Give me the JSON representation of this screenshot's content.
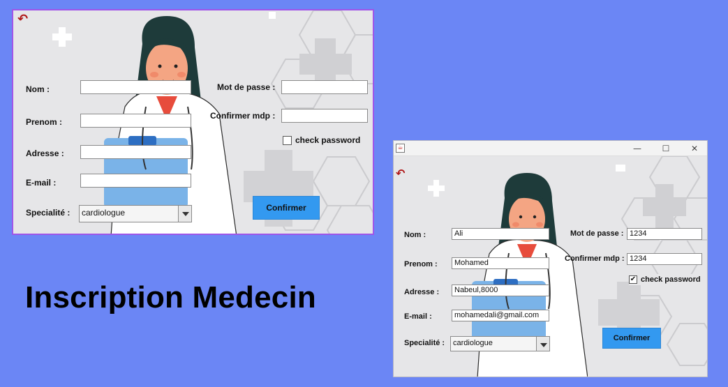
{
  "heading": "Inscription Medecin",
  "icons": {
    "back": "back-arrow-icon",
    "app": "java-icon"
  },
  "window1": {
    "labels": {
      "nom": "Nom :",
      "prenom": "Prenom :",
      "adresse": "Adresse :",
      "email": "E-mail :",
      "specialite": "Specialité :",
      "password": "Mot de passe :",
      "confirm": "Confirmer mdp :"
    },
    "values": {
      "nom": "",
      "prenom": "",
      "adresse": "",
      "email": "",
      "password": "",
      "confirm": ""
    },
    "specialite_selected": "cardiologue",
    "check_label": "check password",
    "check_checked": false,
    "button_label": "Confirmer"
  },
  "window2": {
    "controls": {
      "minimize": "—",
      "maximize": "☐",
      "close": "✕"
    },
    "labels": {
      "nom": "Nom :",
      "prenom": "Prenom :",
      "adresse": "Adresse :",
      "email": "E-mail :",
      "specialite": "Specialité :",
      "password": "Mot de passe :",
      "confirm": "Confirmer mdp :"
    },
    "values": {
      "nom": "Ali",
      "prenom": "Mohamed",
      "adresse": "Nabeul,8000",
      "email": "mohamedali@gmail.com",
      "password": "1234",
      "confirm": "1234"
    },
    "specialite_selected": "cardiologue",
    "check_label": "check password",
    "check_checked": true,
    "check_mark": "✔",
    "button_label": "Confirmer"
  },
  "colors": {
    "background": "#6b86f5",
    "button": "#3399f0",
    "frame_border": "#a055e8",
    "back_icon": "#b01818",
    "scrub": "#e74c3c",
    "hair": "#1e3b3a"
  }
}
